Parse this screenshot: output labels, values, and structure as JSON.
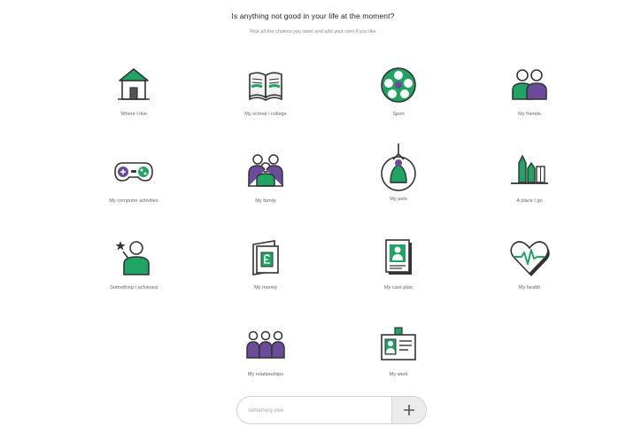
{
  "header": {
    "title": "Is anything not good in your life at the moment?",
    "subtitle": "Pick all the choices you want and add your own if you like"
  },
  "tiles": [
    {
      "label": "Where I live",
      "icon": "house-icon"
    },
    {
      "label": "My school / college",
      "icon": "book-icon"
    },
    {
      "label": "Sport",
      "icon": "football-icon"
    },
    {
      "label": "My friends",
      "icon": "friends-icon"
    },
    {
      "label": "My computer activities",
      "icon": "gamepad-icon"
    },
    {
      "label": "My family",
      "icon": "family-icon"
    },
    {
      "label": "My pets",
      "icon": "pet-icon"
    },
    {
      "label": "A place I go",
      "icon": "place-icon"
    },
    {
      "label": "Something I achieved",
      "icon": "achievement-icon"
    },
    {
      "label": "My money",
      "icon": "wallet-icon"
    },
    {
      "label": "My care plan",
      "icon": "care-plan-icon"
    },
    {
      "label": "My health",
      "icon": "heart-health-icon"
    },
    {
      "label": "My relationships",
      "icon": "relationships-icon"
    },
    {
      "label": "My work",
      "icon": "id-badge-icon"
    }
  ],
  "add_own": {
    "placeholder": "something else",
    "button_icon": "plus-icon"
  },
  "colors": {
    "green": "#1fa463",
    "purple": "#6b4c9a",
    "outline": "#333333",
    "button_bg": "#ececec"
  }
}
